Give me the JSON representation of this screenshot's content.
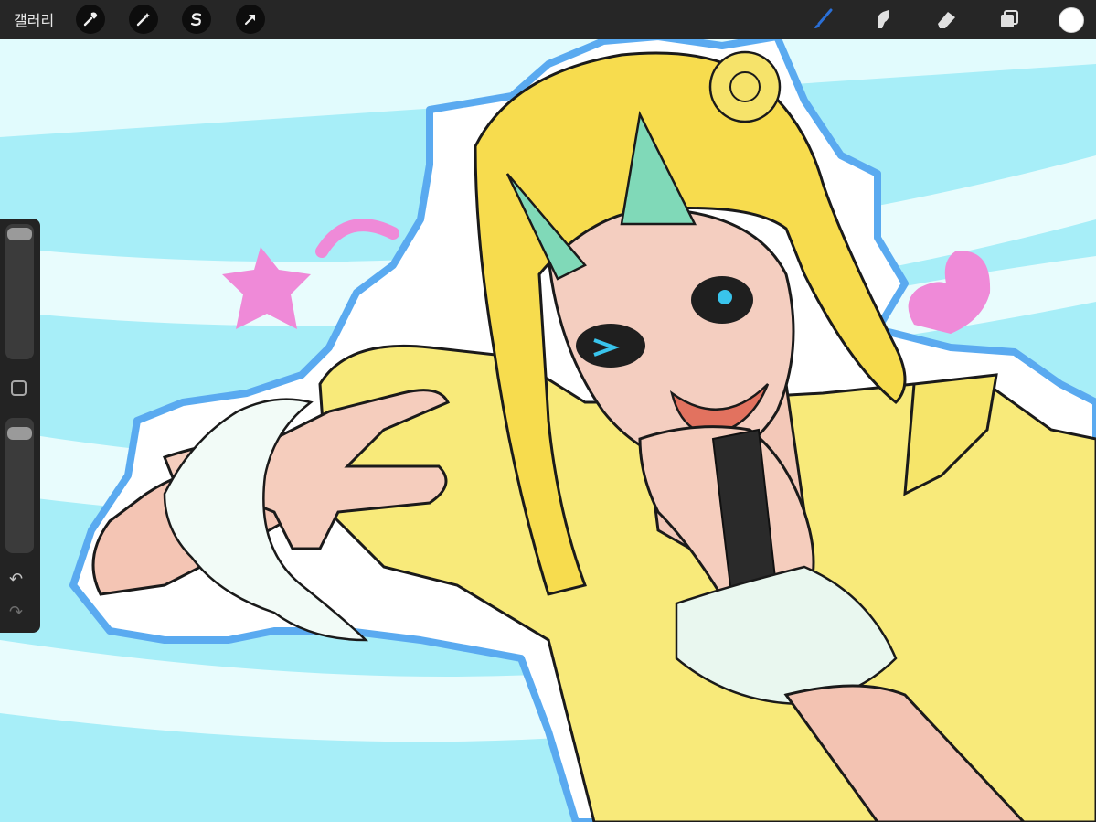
{
  "app": {
    "gallery_label": "갤러리"
  },
  "toolbar_left": {
    "actions_icon": "wrench-icon",
    "adjustments_icon": "magic-wand-icon",
    "selection_icon": "selection-s-icon",
    "transform_icon": "arrow-cursor-icon"
  },
  "toolbar_right": {
    "brush_icon": "brush-icon",
    "smudge_icon": "smudge-icon",
    "eraser_icon": "eraser-icon",
    "layers_icon": "layers-icon",
    "active_color": "#ffffff",
    "brush_active_color": "#2a6fd6"
  },
  "sidebar": {
    "undo_icon": "undo-icon",
    "redo_icon": "redo-icon",
    "brush_size_level": 0.95,
    "opacity_level": 0.95
  },
  "artwork": {
    "background_stripes": [
      "#a6eef8",
      "#e6fbfd"
    ],
    "outline_color": "#5aaaf0",
    "hair_color": "#f7dd52",
    "accent_teal": "#80d9b8",
    "pink_accent": "#ef8ad8",
    "eye_color": "#39c4ec"
  }
}
